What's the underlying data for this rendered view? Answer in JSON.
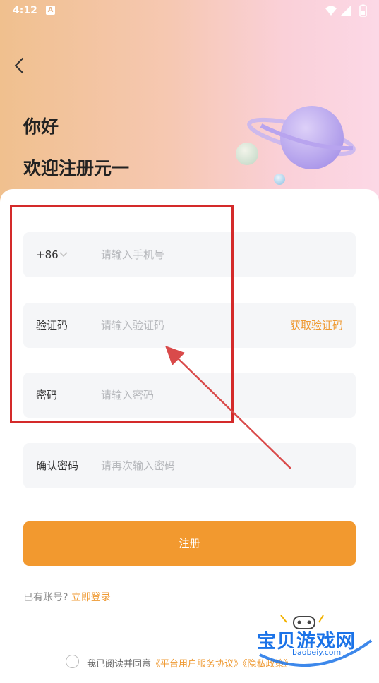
{
  "status_bar": {
    "time": "4:12",
    "notification_badge": "A"
  },
  "header": {
    "greeting": "你好",
    "welcome": "欢迎注册元一"
  },
  "form": {
    "phone": {
      "country_code": "+86",
      "placeholder": "请输入手机号"
    },
    "code": {
      "label": "验证码",
      "placeholder": "请输入验证码",
      "get_code_label": "获取验证码"
    },
    "password": {
      "label": "密码",
      "placeholder": "请输入密码"
    },
    "confirm": {
      "label": "确认密码",
      "placeholder": "请再次输入密码"
    },
    "register_label": "注册"
  },
  "login": {
    "question": "已有账号?",
    "link": "立即登录"
  },
  "agreement": {
    "prefix": "我已阅读并同意",
    "terms": "《平台用户服务协议》",
    "privacy": "《隐私政策》"
  },
  "watermark": {
    "title": "宝贝游戏网",
    "url": "baobeiy.com"
  },
  "colors": {
    "accent": "#F2992F",
    "annotation": "#D42A2A",
    "watermark": "#1B73E8"
  }
}
